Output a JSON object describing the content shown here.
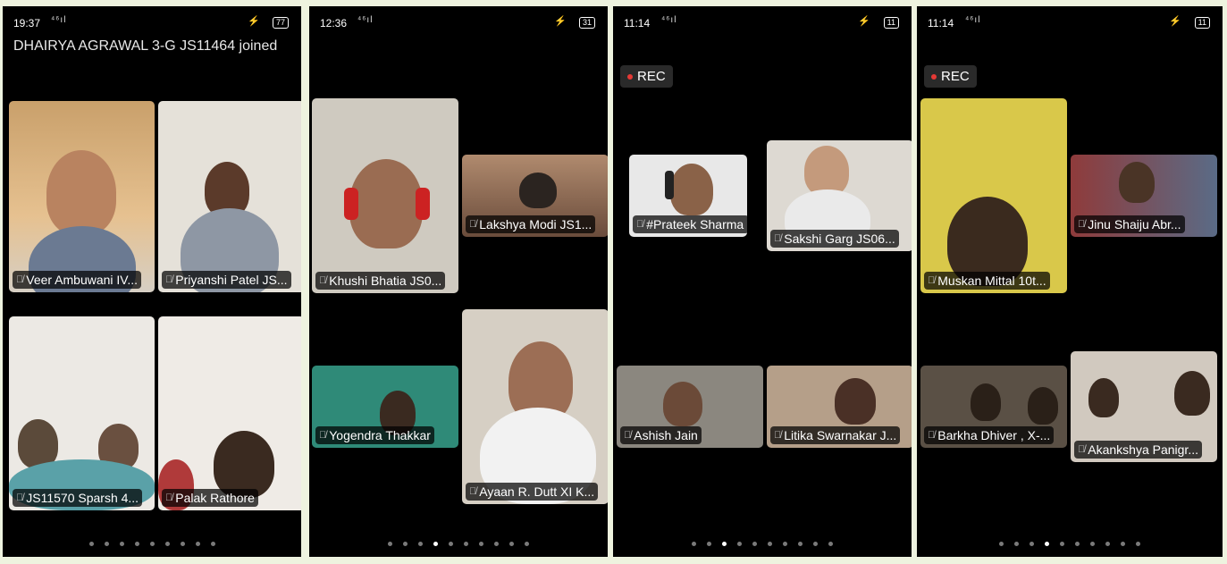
{
  "panels": [
    {
      "status": {
        "time": "19:37",
        "signal": "⁴⁶ıl",
        "battery": "77"
      },
      "notice": "DHAIRYA AGRAWAL 3-G JS11464 joined",
      "tiles": [
        {
          "name": "Veer Ambuwani IV...",
          "bg": "#c9a06b"
        },
        {
          "name": "Priyanshi Patel JS...",
          "bg": "#d8d1c5"
        },
        {
          "name": "JS11570 Sparsh 4...",
          "bg": "#c8c6c3"
        },
        {
          "name": "Palak Rathore",
          "bg": "#e2ddd6"
        }
      ],
      "page_dots": 9,
      "active_dot": -1
    },
    {
      "status": {
        "time": "12:36",
        "signal": "⁴⁶ıl",
        "battery": "31"
      },
      "tiles": [
        {
          "name": "Khushi Bhatia JS0...",
          "bg": "#c7c1b2"
        },
        {
          "name": "Lakshya Modi JS1...",
          "bg": "#6a4c3b"
        },
        {
          "name": "Yogendra Thakkar",
          "bg": "#2f8a78"
        },
        {
          "name": "Ayaan R. Dutt XI K...",
          "bg": "#b69a7a"
        }
      ],
      "page_dots": 10,
      "active_dot": 3
    },
    {
      "status": {
        "time": "11:14",
        "signal": "⁴⁶ıl",
        "battery": "11"
      },
      "rec": "REC",
      "tiles": [
        {
          "name": "#Prateek Sharma ...",
          "bg": "#3a3a3a"
        },
        {
          "name": "Sakshi Garg JS06...",
          "bg": "#d9d6cf"
        },
        {
          "name": "Ashish Jain",
          "bg": "#8b877f"
        },
        {
          "name": "Litika Swarnakar J...",
          "bg": "#b59f89"
        }
      ],
      "page_dots": 10,
      "active_dot": 2
    },
    {
      "status": {
        "time": "11:14",
        "signal": "⁴⁶ıl",
        "battery": "11"
      },
      "rec": "REC",
      "tiles": [
        {
          "name": "Muskan Mittal 10t...",
          "bg": "#d9c84a"
        },
        {
          "name": "Jinu Shaiju Abr...",
          "bg": "#8f3b3b"
        },
        {
          "name": "Barkha Dhiver , X-...",
          "bg": "#5a5045"
        },
        {
          "name": "Akankshya Panigr...",
          "bg": "#d1c9bf"
        }
      ],
      "page_dots": 10,
      "active_dot": 3
    }
  ]
}
